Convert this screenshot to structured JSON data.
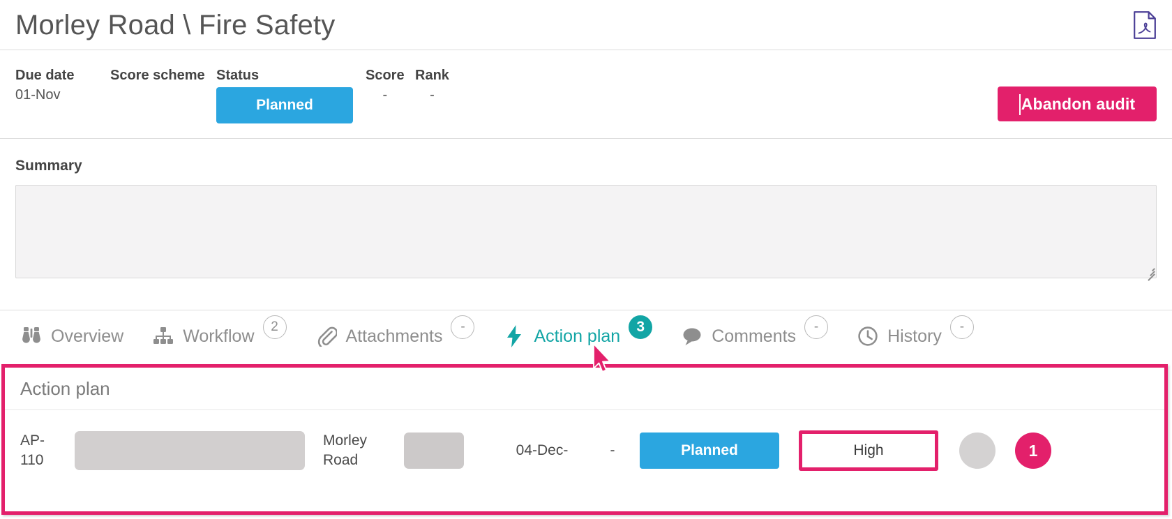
{
  "header": {
    "title": "Morley Road \\ Fire Safety",
    "pdf_icon": "pdf-document-icon"
  },
  "meta": {
    "due_date_label": "Due date",
    "due_date_value": "01-Nov",
    "score_scheme_label": "Score scheme",
    "score_scheme_value": "",
    "status_label": "Status",
    "status_value": "Planned",
    "score_label": "Score",
    "score_value": "-",
    "rank_label": "Rank",
    "rank_value": "-",
    "abandon_label": "Abandon audit"
  },
  "summary": {
    "label": "Summary",
    "value": "",
    "placeholder": ""
  },
  "tabs": [
    {
      "label": "Overview",
      "icon": "binoculars-icon",
      "badge": "",
      "badge_filled": false,
      "active": false
    },
    {
      "label": "Workflow",
      "icon": "sitemap-icon",
      "badge": "2",
      "badge_filled": false,
      "active": false
    },
    {
      "label": "Attachments",
      "icon": "paperclip-icon",
      "badge": "-",
      "badge_filled": false,
      "active": false
    },
    {
      "label": "Action plan",
      "icon": "lightning-icon",
      "badge": "3",
      "badge_filled": true,
      "active": true
    },
    {
      "label": "Comments",
      "icon": "comment-icon",
      "badge": "-",
      "badge_filled": false,
      "active": false
    },
    {
      "label": "History",
      "icon": "clock-icon",
      "badge": "-",
      "badge_filled": false,
      "active": false
    }
  ],
  "action_plan": {
    "panel_title": "Action plan",
    "rows": [
      {
        "id": "AP-110",
        "description": "",
        "site": "Morley Road",
        "field_blank": "",
        "date": "04-Dec-",
        "dash": "-",
        "status": "Planned",
        "priority": "High",
        "assignee": "",
        "count": "1"
      }
    ]
  },
  "colors": {
    "accent_pink": "#e3206b",
    "status_blue": "#2ba6e0",
    "active_teal": "#12a5a5",
    "pdf_purple": "#4b3f96",
    "muted_gray": "#8e8e8e"
  }
}
